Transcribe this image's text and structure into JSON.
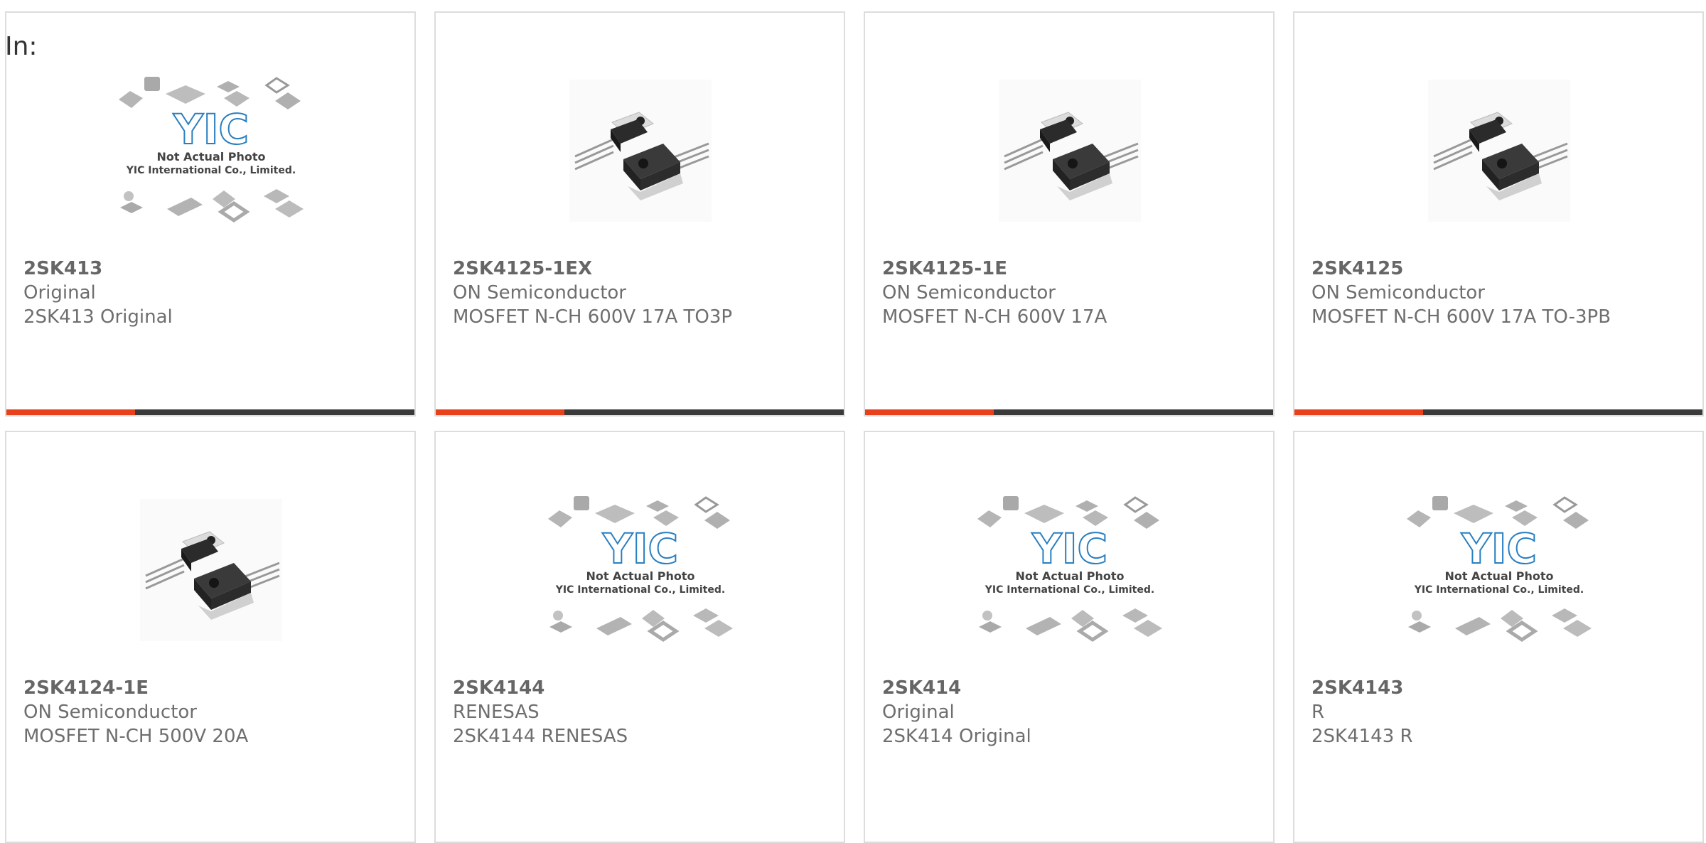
{
  "header": {
    "label": "In:"
  },
  "colors": {
    "accent": "#e8401b",
    "bar": "#3a3a3a",
    "logo": "#2a7fc0"
  },
  "placeholder_image": {
    "caption_line1": "Not Actual Photo",
    "caption_line2": "YIC International Co., Limited."
  },
  "products": [
    {
      "part": "2SK413",
      "manufacturer": "Original",
      "description": "2SK413 Original",
      "image": "placeholder-chips-icon"
    },
    {
      "part": "2SK4125-1EX",
      "manufacturer": "ON Semiconductor",
      "description": "MOSFET N-CH 600V 17A TO3P",
      "image": "to3p-package-icon"
    },
    {
      "part": "2SK4125-1E",
      "manufacturer": "ON Semiconductor",
      "description": "MOSFET N-CH 600V 17A",
      "image": "to3p-package-icon"
    },
    {
      "part": "2SK4125",
      "manufacturer": "ON Semiconductor",
      "description": "MOSFET N-CH 600V 17A TO-3PB",
      "image": "to3p-package-icon"
    },
    {
      "part": "2SK4124-1E",
      "manufacturer": "ON Semiconductor",
      "description": "MOSFET N-CH 500V 20A",
      "image": "to3p-package-icon"
    },
    {
      "part": "2SK4144",
      "manufacturer": "RENESAS",
      "description": "2SK4144 RENESAS",
      "image": "placeholder-chips-icon"
    },
    {
      "part": "2SK414",
      "manufacturer": "Original",
      "description": "2SK414 Original",
      "image": "placeholder-chips-icon"
    },
    {
      "part": "2SK4143",
      "manufacturer": "R",
      "description": "2SK4143 R",
      "image": "placeholder-chips-icon"
    }
  ]
}
